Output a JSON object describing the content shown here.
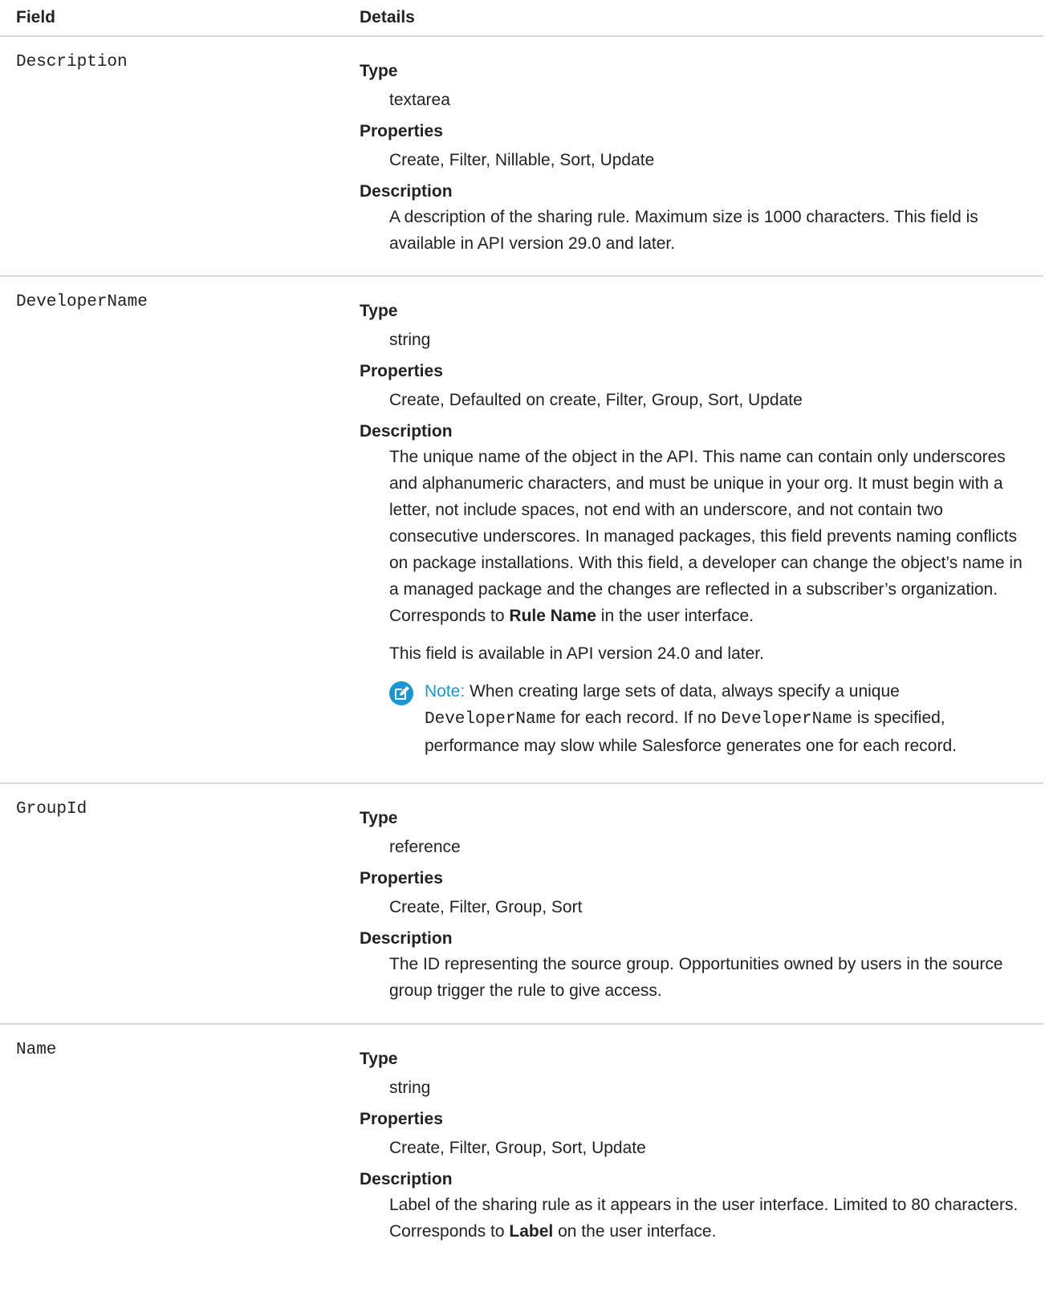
{
  "header": {
    "field": "Field",
    "details": "Details"
  },
  "rows": [
    {
      "field": "Description",
      "type_label": "Type",
      "type": "textarea",
      "properties_label": "Properties",
      "properties": "Create, Filter, Nillable, Sort, Update",
      "description_label": "Description",
      "description": "A description of the sharing rule. Maximum size is 1000 characters. This field is available in API version 29.0 and later."
    },
    {
      "field": "DeveloperName",
      "type_label": "Type",
      "type": "string",
      "properties_label": "Properties",
      "properties": "Create, Defaulted on create, Filter, Group, Sort, Update",
      "description_label": "Description",
      "description_part1": "The unique name of the object in the API. This name can contain only underscores and alphanumeric characters, and must be unique in your org. It must begin with a letter, not include spaces, not end with an underscore, and not contain two consecutive underscores. In managed packages, this field prevents naming conflicts on package installations. With this field, a developer can change the object’s name in a managed package and the changes are reflected in a subscriber’s organization. Corresponds to ",
      "description_bold": "Rule Name",
      "description_part2": " in the user interface.",
      "availability": "This field is available in API version 24.0 and later.",
      "note": {
        "icon": "note-edit-icon",
        "label": "Note:",
        "text1": " When creating large sets of data, always specify a unique ",
        "code1": "DeveloperName",
        "text2": " for each record. If no ",
        "code2": "DeveloperName",
        "text3": " is specified, performance may slow while Salesforce generates one for each record."
      }
    },
    {
      "field": "GroupId",
      "type_label": "Type",
      "type": "reference",
      "properties_label": "Properties",
      "properties": "Create, Filter, Group, Sort",
      "description_label": "Description",
      "description": "The ID representing the source group. Opportunities owned by users in the source group trigger the rule to give access."
    },
    {
      "field": "Name",
      "type_label": "Type",
      "type": "string",
      "properties_label": "Properties",
      "properties": "Create, Filter, Group, Sort, Update",
      "description_label": "Description",
      "description_part1": "Label of the sharing rule as it appears in the user interface. Limited to 80 characters. Corresponds to ",
      "description_bold": "Label",
      "description_part2": " on the user interface."
    }
  ],
  "colors": {
    "note_accent": "#1b96d2",
    "divider": "#d8d8d8"
  }
}
